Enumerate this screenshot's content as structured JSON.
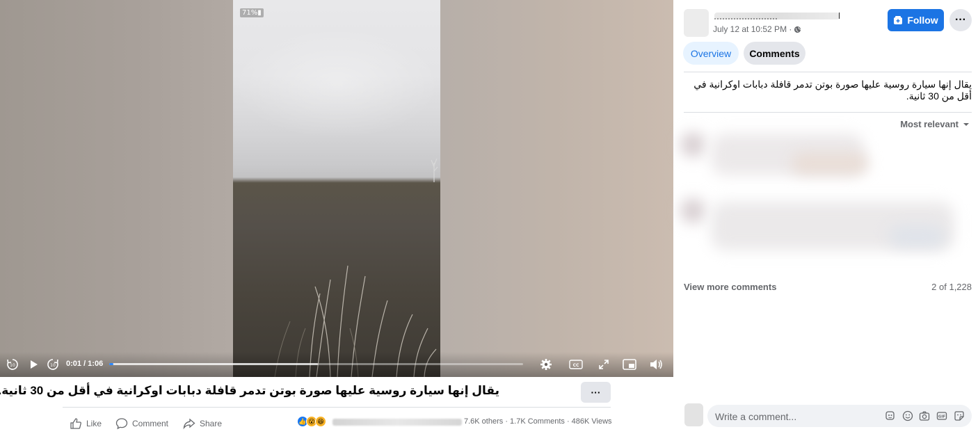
{
  "video": {
    "badge_text": "71%▮",
    "time_display": "0:01 / 1:06",
    "progress_fraction": 0.01,
    "buffered_fraction": 0.505
  },
  "caption": {
    "title": "يقال إنها سيارة روسية عليها صورة بوتن تدمر قافلة دبابات اوكرانية في أقل من 30 ثانية.",
    "more_label": "···",
    "actions": {
      "like": "Like",
      "comment": "Comment",
      "share": "Share"
    },
    "stats": "7.6K others · 1.7K Comments · 486K Views"
  },
  "sidebar": {
    "post_date": "July 12 at 10:52 PM ·",
    "follow_label": "Follow",
    "more_label": "···",
    "tabs": [
      {
        "label": "Overview",
        "active": true
      },
      {
        "label": "Comments",
        "active": false
      }
    ],
    "post_text": "يقال إنها سيارة روسية عليها صورة بوتن تدمر قافلة دبابات اوكرانية في أقل من 30 ثانية.",
    "sort_label": "Most relevant",
    "view_more_label": "View more comments",
    "comment_count": "2 of 1,228",
    "comment_placeholder": "Write a comment..."
  },
  "colors": {
    "accent": "#1b74e4",
    "progress": "#2d88ff",
    "secondary_text": "#65676b"
  }
}
